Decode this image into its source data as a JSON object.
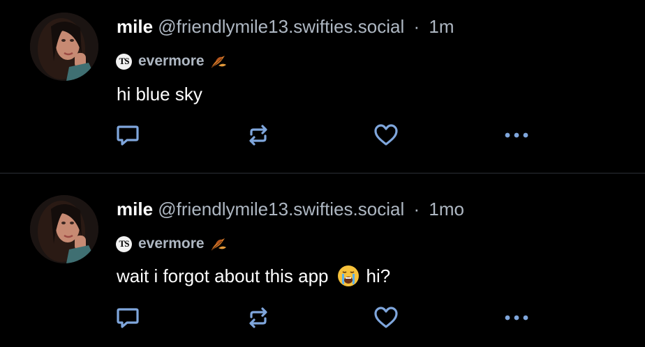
{
  "posts": [
    {
      "display_name": "mile",
      "handle": "@friendlymile13.swifties.social",
      "separator": "·",
      "timestamp": "1m",
      "label": {
        "badge": "TS",
        "text": "evermore"
      },
      "text": "hi blue sky",
      "text_after_emoji": ""
    },
    {
      "display_name": "mile",
      "handle": "@friendlymile13.swifties.social",
      "separator": "·",
      "timestamp": "1mo",
      "label": {
        "badge": "TS",
        "text": "evermore"
      },
      "text": "wait i forgot about this app",
      "text_after_emoji": "hi?"
    }
  ],
  "icons": {
    "reply": "reply-icon",
    "repost": "repost-icon",
    "like": "heart-icon",
    "more": "more-options-icon",
    "leaf": "autumn-leaf-icon",
    "emoji": "loudly-crying-face-emoji"
  },
  "colors": {
    "background": "#000000",
    "text_primary": "#ffffff",
    "text_secondary": "#aeb7c2",
    "action_icon": "#7fa6dc",
    "divider": "#2b2f36"
  }
}
